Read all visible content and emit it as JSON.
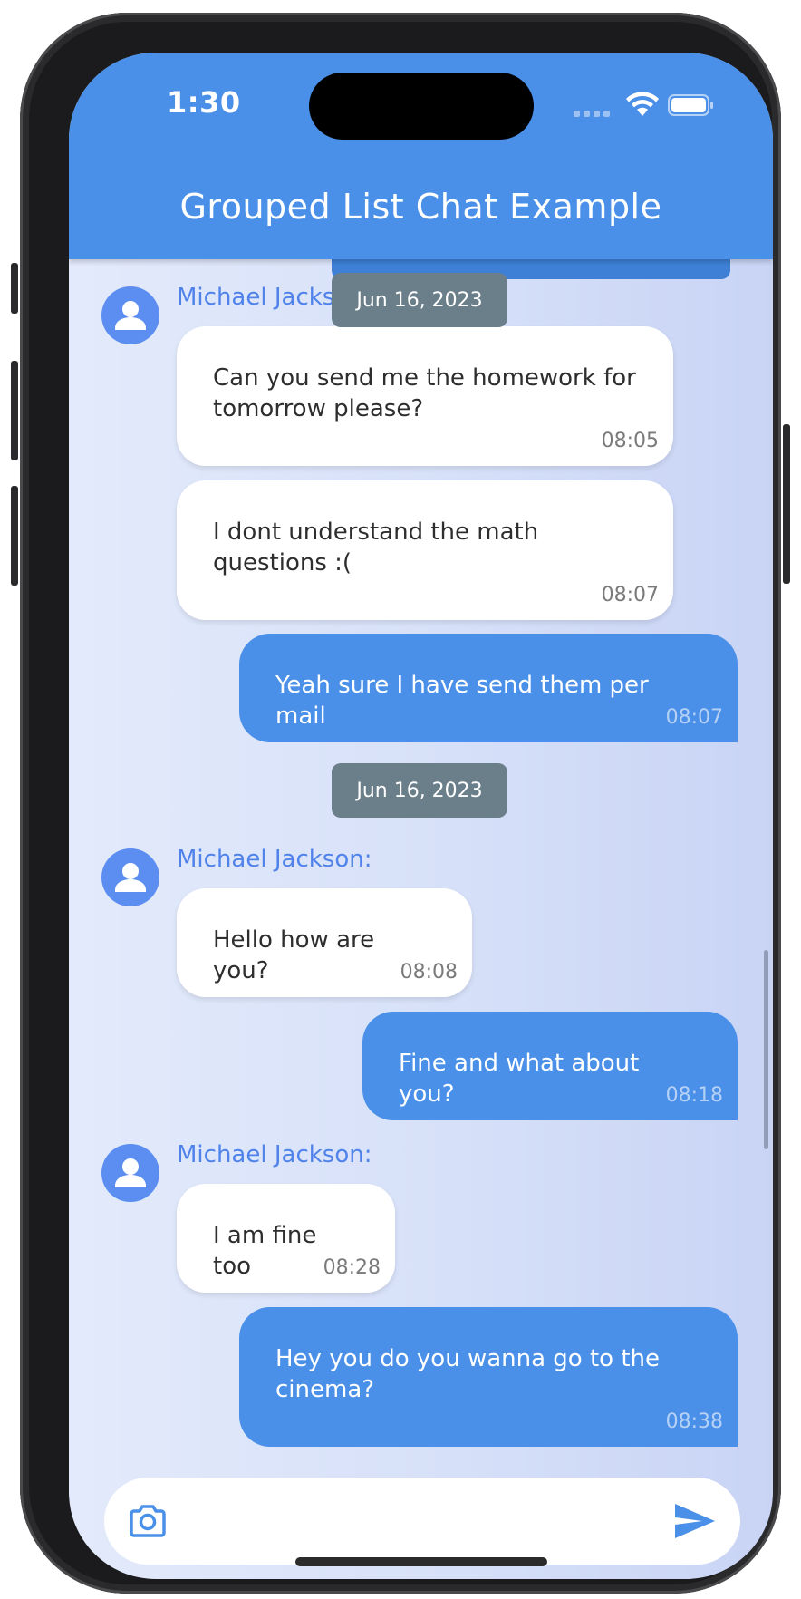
{
  "status_bar": {
    "time": "1:30"
  },
  "app_bar": {
    "title": "Grouped List Chat Example"
  },
  "messages_top": {
    "date_chip": "Jun 16, 2023",
    "sender": "Michael Jackson:",
    "incoming": [
      {
        "text": "Can you send me the homework for tomorrow please?",
        "time": "08:05"
      },
      {
        "text": "I dont understand the math questions :(",
        "time": "08:07"
      }
    ],
    "outgoing": {
      "text": "Yeah sure I have send them per mail",
      "time": "08:07"
    }
  },
  "messages_group": {
    "date_chip": "Jun 16, 2023",
    "sender_1": "Michael Jackson:",
    "incoming_1": {
      "text": "Hello how are you?",
      "time": "08:08"
    },
    "outgoing_1": {
      "text": "Fine and what about you?",
      "time": "08:18"
    },
    "sender_2": "Michael Jackson:",
    "incoming_2": {
      "text": "I am fine too",
      "time": "08:28"
    },
    "outgoing_2": {
      "text": "Hey you do you wanna go to the cinema?",
      "time": "08:38"
    }
  },
  "composer": {
    "placeholder": "",
    "value": ""
  },
  "icons": {
    "camera": "camera-icon",
    "send": "send-icon",
    "avatar": "person-icon"
  },
  "colors": {
    "header": "#4a90e8",
    "outgoing_bubble": "#4a90e8",
    "incoming_bubble": "#ffffff",
    "sender_name": "#4f83ea",
    "date_chip": "#6b7f8a",
    "avatar": "#5b8ef0"
  }
}
